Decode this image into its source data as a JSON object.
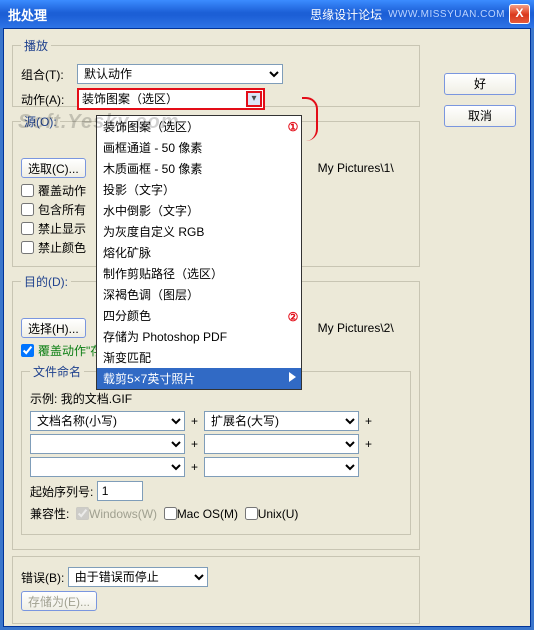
{
  "titlebar": {
    "title": "批处理",
    "brand": "思缘设计论坛",
    "url": "WWW.MISSYUAN.COM",
    "close": "X"
  },
  "buttons": {
    "ok": "好",
    "cancel": "取消"
  },
  "play": {
    "legend": "播放",
    "combo_label": "组合(T):",
    "combo_value": "默认动作",
    "action_label": "动作(A):",
    "action_value": "装饰图案（选区）",
    "options": [
      "装饰图案（选区）",
      "画框通道 - 50 像素",
      "木质画框 - 50 像素",
      "投影（文字）",
      "水中倒影（文字）",
      "为灰度自定义 RGB",
      "熔化矿脉",
      "制作剪贴路径（选区）",
      "深褐色调（图层）",
      "四分颜色",
      "存储为 Photoshop PDF",
      "渐变匹配",
      "载剪5×7英寸照片"
    ],
    "annot1": "①",
    "annot2": "②"
  },
  "source": {
    "legend": "源(O):",
    "browse": "选取(C)...",
    "path1": "My Pictures\\1\\",
    "chk1": "覆盖动作",
    "chk2": "包含所有",
    "chk3": "禁止显示",
    "chk4": "禁止颜色"
  },
  "dest": {
    "legend": "目的(D):",
    "browse": "选择(H)...",
    "path2": "My Pictures\\2\\",
    "override": "覆盖动作\"存储为\"命令(V)",
    "naming_legend": "文件命名",
    "example_label": "示例:",
    "example_value": "我的文档.GIF",
    "name1": "文档名称(小写)",
    "name2": "扩展名(大写)",
    "empty": "",
    "start_label": "起始序列号:",
    "start_value": "1",
    "compat_label": "兼容性:",
    "win": "Windows(W)",
    "mac": "Mac OS(M)",
    "unix": "Unix(U)"
  },
  "error": {
    "label": "错误(B):",
    "value": "由于错误而停止",
    "saveas": "存储为(E)..."
  },
  "watermark": "Soft.Yesky.com"
}
